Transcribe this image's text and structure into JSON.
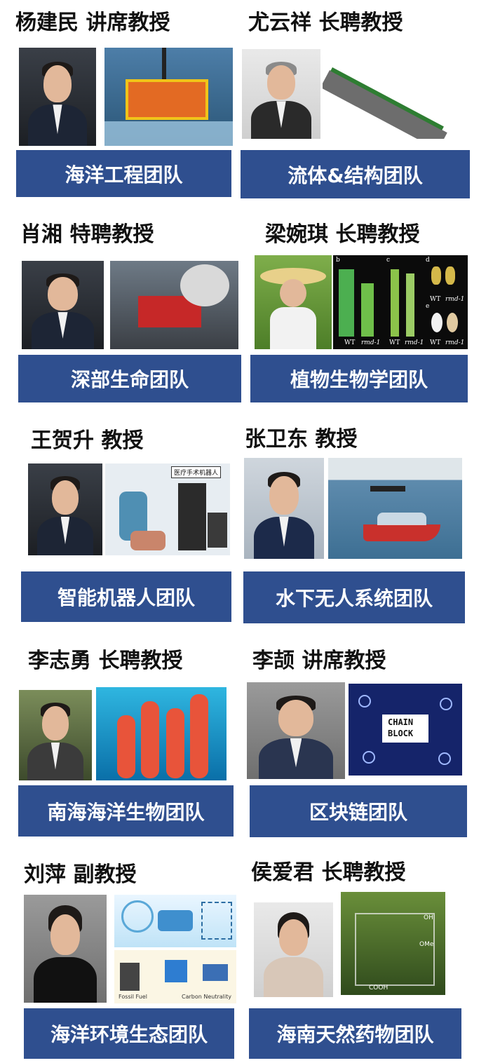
{
  "cards": [
    {
      "name": "杨建民 讲席教授",
      "team": "海洋工程团队"
    },
    {
      "name": "尤云祥 长聘教授",
      "team": "流体&结构团队"
    },
    {
      "name": "肖湘 特聘教授",
      "team": "深部生命团队"
    },
    {
      "name": "梁婉琪 长聘教授",
      "team": "植物生物学团队",
      "figure_labels": [
        "b",
        "c",
        "d",
        "e",
        "WT",
        "rmd-1",
        "WT",
        "rmd-1",
        "WT",
        "rmd-1",
        "WT",
        "rmd-1"
      ]
    },
    {
      "name": "王贺升 教授",
      "team": "智能机器人团队",
      "figure_labels": [
        "医疗手术机器人"
      ]
    },
    {
      "name": "张卫东 教授",
      "team": "水下无人系统团队"
    },
    {
      "name": "李志勇 长聘教授",
      "team": "南海海洋生物团队"
    },
    {
      "name": "李颉 讲席教授",
      "team": "区块链团队",
      "figure_labels": [
        "CHAIN",
        "BLOCK"
      ]
    },
    {
      "name": "刘萍 副教授",
      "team": "海洋环境生态团队",
      "figure_labels": [
        "Fossil Fuel",
        "Carbon Neutrality"
      ]
    },
    {
      "name": "侯爱君 长聘教授",
      "team": "海南天然药物团队",
      "figure_labels": [
        "OH",
        "OMe",
        "COOH"
      ]
    }
  ],
  "colors": {
    "team_banner": "#2f4f8f",
    "banner_text": "#ffffff"
  }
}
